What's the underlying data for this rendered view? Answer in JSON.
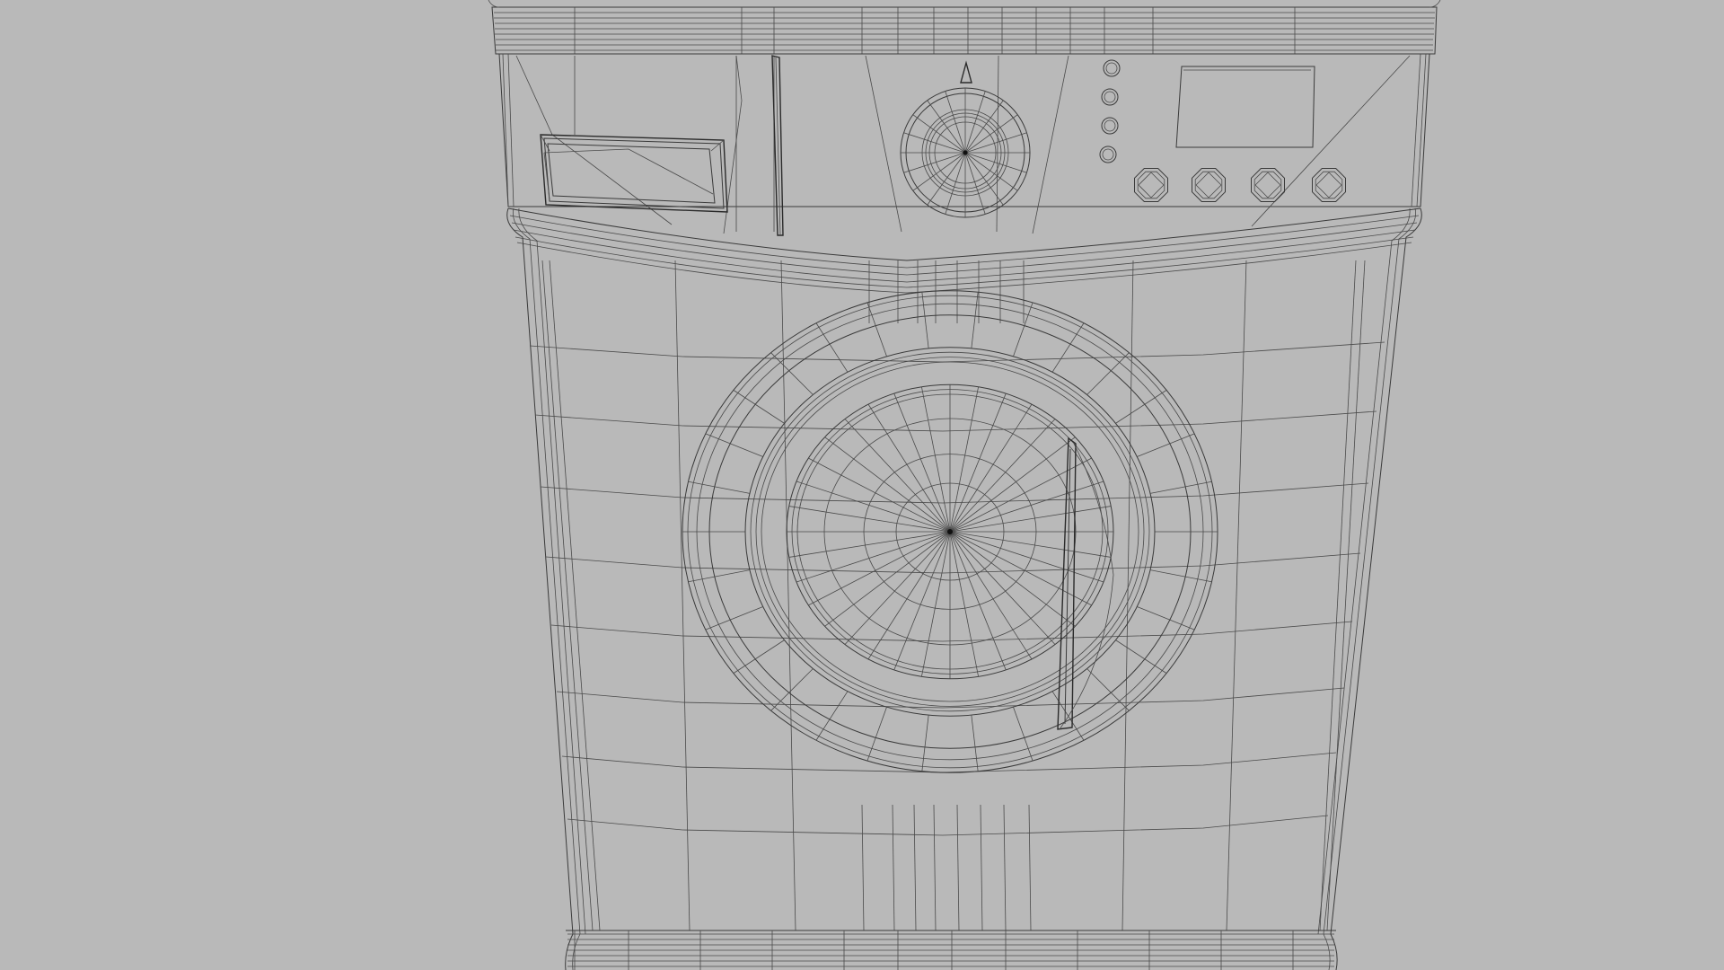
{
  "scene": {
    "background_color": "#b9b9b9",
    "wire_color": "#3a3a3a",
    "subject": "washing-machine-wireframe"
  }
}
